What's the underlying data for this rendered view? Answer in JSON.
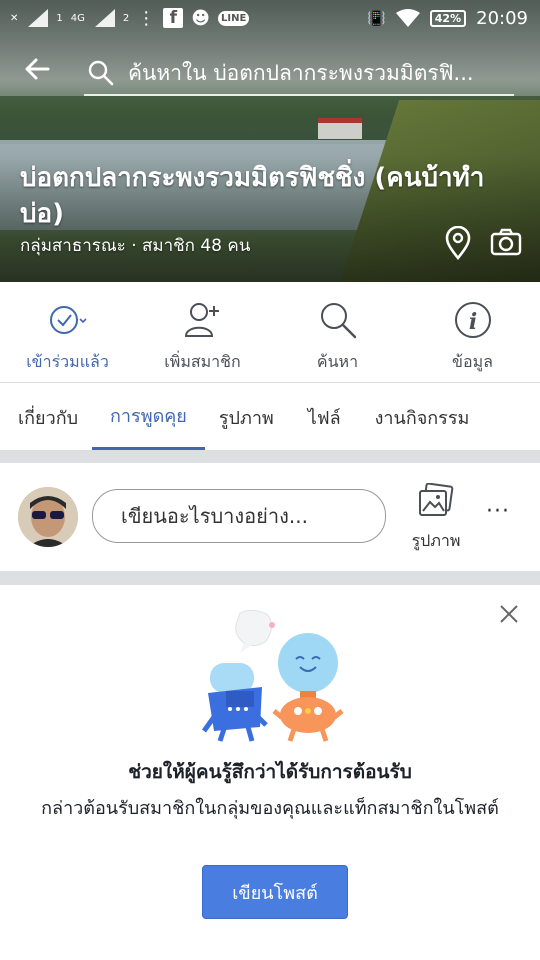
{
  "status_bar": {
    "network_label": "4G",
    "sim1": "1",
    "sim2": "2",
    "line_badge": "LINE",
    "battery": "42%",
    "time": "20:09"
  },
  "header": {
    "search_text": "ค้นหาใน บ่อตกปลากระพงรวมมิตรฟิ..."
  },
  "group": {
    "title": "บ่อตกปลากระพงรวมมิตรฟิชชิ่ง (คนบ้าทำบ่อ)",
    "subtitle": "กลุ่มสาธารณะ · สมาชิก 48 คน"
  },
  "actions": [
    {
      "label": "เข้าร่วมแล้ว",
      "icon": "joined-check-icon"
    },
    {
      "label": "เพิ่มสมาชิก",
      "icon": "add-member-icon"
    },
    {
      "label": "ค้นหา",
      "icon": "search-icon"
    },
    {
      "label": "ข้อมูล",
      "icon": "info-icon"
    }
  ],
  "tabs": [
    {
      "label": "เกี่ยวกับ"
    },
    {
      "label": "การพูดคุย"
    },
    {
      "label": "รูปภาพ"
    },
    {
      "label": "ไฟล์"
    },
    {
      "label": "งานกิจกรรม"
    }
  ],
  "composer": {
    "placeholder": "เขียนอะไรบางอย่าง...",
    "photo_label": "รูปภาพ",
    "more": "···"
  },
  "welcome_card": {
    "title": "ช่วยให้ผู้คนรู้สึกว่าได้รับการต้อนรับ",
    "description": "กล่าวต้อนรับสมาชิกในกลุ่มของคุณและแท็กสมาชิกในโพสต์",
    "button": "เขียนโพสต์"
  },
  "colors": {
    "accent": "#4267b2",
    "button": "#4a7de0",
    "divider": "#dddfe2"
  }
}
